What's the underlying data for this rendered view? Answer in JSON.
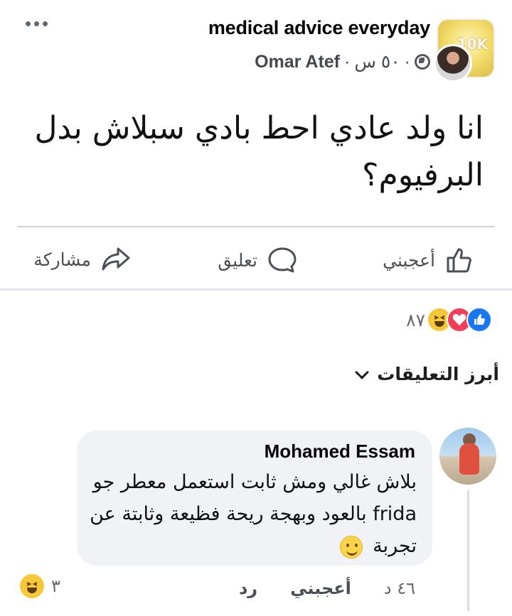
{
  "post": {
    "group_name": "medical advice everyday",
    "author": "Omar Atef",
    "time": "٥٠ س",
    "separator": "·",
    "text": "انا ولد عادي احط بادي سبلاش بدل البرفيوم؟",
    "group_avatar_text": "10K"
  },
  "actions": {
    "like": "أعجبني",
    "comment": "تعليق",
    "share": "مشاركة"
  },
  "reactions": {
    "count": "٨٧",
    "types": [
      "like-icon",
      "love-icon",
      "haha-icon"
    ]
  },
  "comments_filter": {
    "label": "أبرز التعليقات"
  },
  "comment": {
    "author": "Mohamed Essam",
    "text_before": "بلاش غالي ومش ثابت استعمل معطر جو frida بالعود وبهجة ريحة فظيعة وثابتة عن تجربة",
    "emoji": "smile-icon",
    "time": "٤٦ د",
    "like": "أعجبني",
    "reply": "رد",
    "reaction_count": "٣",
    "reaction_type": "haha-icon"
  },
  "colors": {
    "like_blue": "#1877f2",
    "love_red": "#f33e58",
    "haha_yellow": "#f7c839",
    "bubble_bg": "#f0f2f5",
    "meta_gray": "#65676b"
  }
}
